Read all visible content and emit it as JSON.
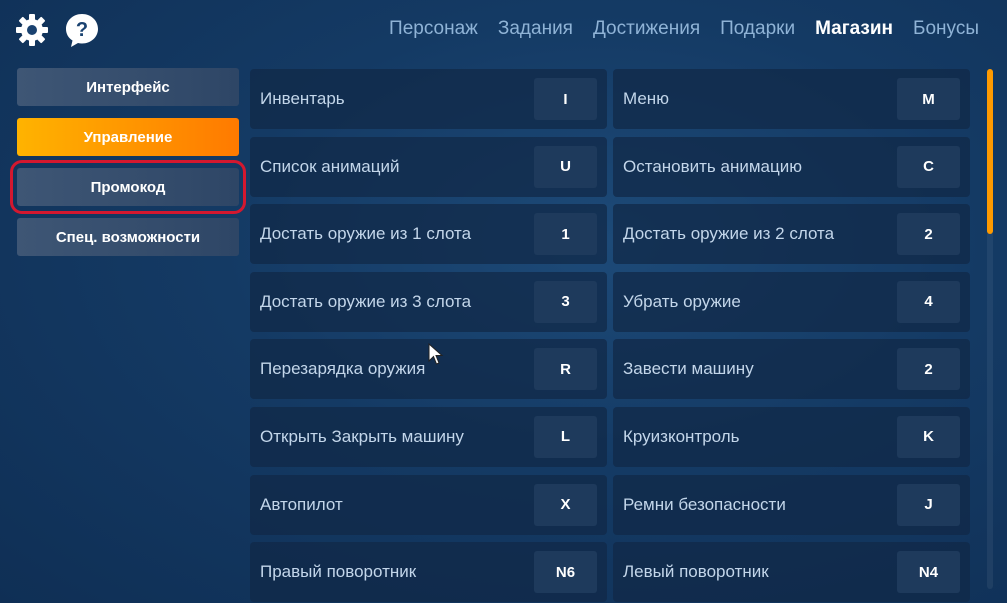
{
  "header": {
    "nav": [
      {
        "label": "Персонаж",
        "active": false
      },
      {
        "label": "Задания",
        "active": false
      },
      {
        "label": "Достижения",
        "active": false
      },
      {
        "label": "Подарки",
        "active": false
      },
      {
        "label": "Магазин",
        "active": true
      },
      {
        "label": "Бонусы",
        "active": false
      }
    ],
    "icons": [
      "gear-icon",
      "help-bubble-icon"
    ]
  },
  "sidebar": {
    "items": [
      {
        "label": "Интерфейс",
        "active": false
      },
      {
        "label": "Управление",
        "active": true
      },
      {
        "label": "Промокод",
        "active": false,
        "highlighted": true
      },
      {
        "label": "Спец. возможности",
        "active": false
      }
    ]
  },
  "keybinds": [
    [
      {
        "label": "Инвентарь",
        "key": "I"
      },
      {
        "label": "Меню",
        "key": "M"
      }
    ],
    [
      {
        "label": "Список анимаций",
        "key": "U"
      },
      {
        "label": "Остановить анимацию",
        "key": "C"
      }
    ],
    [
      {
        "label": "Достать оружие из 1 слота",
        "key": "1"
      },
      {
        "label": "Достать оружие из 2 слота",
        "key": "2"
      }
    ],
    [
      {
        "label": "Достать оружие из 3 слота",
        "key": "3"
      },
      {
        "label": "Убрать оружие",
        "key": "4"
      }
    ],
    [
      {
        "label": "Перезарядка оружия",
        "key": "R"
      },
      {
        "label": "Завести машину",
        "key": "2"
      }
    ],
    [
      {
        "label": "Открыть Закрыть машину",
        "key": "L"
      },
      {
        "label": "Круизконтроль",
        "key": "K"
      }
    ],
    [
      {
        "label": "Автопилот",
        "key": "X"
      },
      {
        "label": "Ремни безопасности",
        "key": "J"
      }
    ],
    [
      {
        "label": "Правый поворотник",
        "key": "N6"
      },
      {
        "label": "Левый поворотник",
        "key": "N4"
      }
    ]
  ],
  "colors": {
    "accent": "#ff9a00",
    "highlight_ring": "#d3182f",
    "background": "#143a64"
  }
}
